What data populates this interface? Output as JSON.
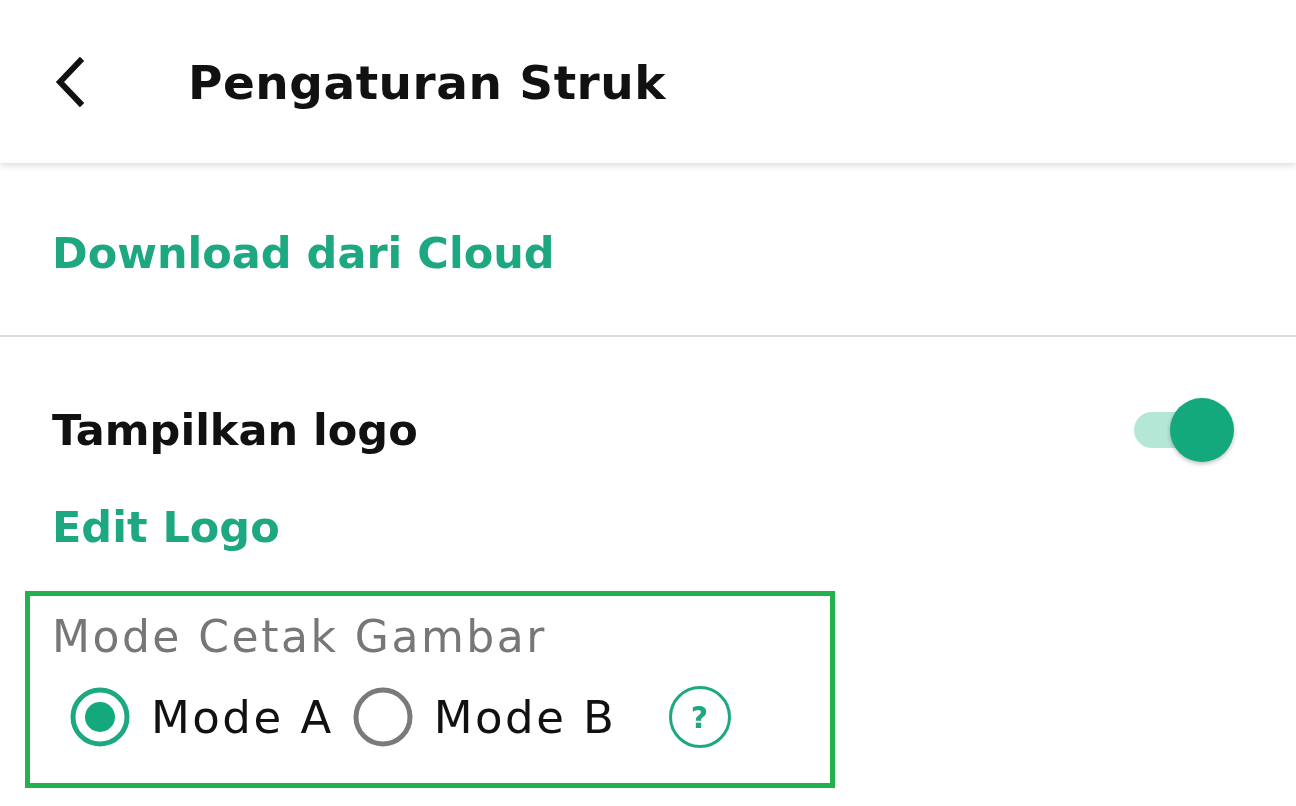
{
  "header": {
    "title": "Pengaturan Struk"
  },
  "download_link": {
    "label": "Download dari Cloud"
  },
  "logo_toggle": {
    "label": "Tampilkan logo",
    "on": true
  },
  "edit_logo_link": {
    "label": "Edit Logo"
  },
  "print_mode": {
    "label": "Mode Cetak Gambar",
    "highlighted": true,
    "options": [
      {
        "label": "Mode A",
        "selected": true
      },
      {
        "label": "Mode B",
        "selected": false
      }
    ],
    "help": "?"
  }
}
